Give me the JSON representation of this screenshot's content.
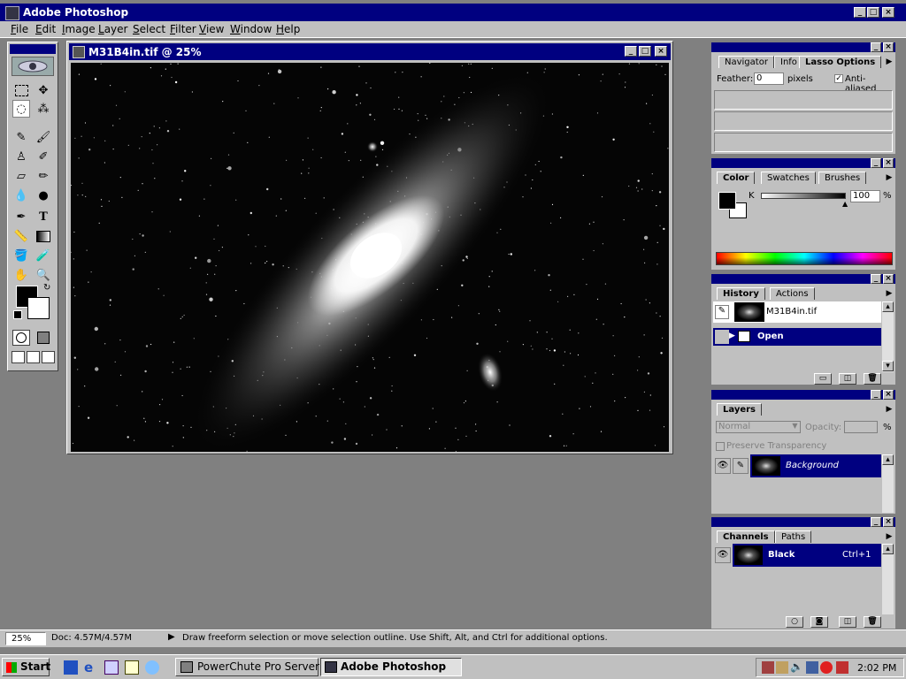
{
  "app": {
    "title": "Adobe Photoshop"
  },
  "menu": [
    "File",
    "Edit",
    "Image",
    "Layer",
    "Select",
    "Filter",
    "View",
    "Window",
    "Help"
  ],
  "document": {
    "title": "M31B4in.tif @ 25%"
  },
  "lasso_palette": {
    "tabs": [
      "Navigator",
      "Info",
      "Lasso Options"
    ],
    "feather_label": "Feather:",
    "feather_value": "0",
    "feather_unit": "pixels",
    "antialiased_label": "Anti-aliased",
    "antialiased_checked": true
  },
  "color_palette": {
    "tabs": [
      "Color",
      "Swatches",
      "Brushes"
    ],
    "channel_label": "K",
    "channel_value": "100",
    "channel_unit": "%",
    "slider_fraction": 1.0
  },
  "history_palette": {
    "tabs": [
      "History",
      "Actions"
    ],
    "snapshot_name": "M31B4in.tif",
    "state_name": "Open"
  },
  "layers_palette": {
    "tabs": [
      "Layers"
    ],
    "blend_mode": "Normal",
    "opacity_label": "Opacity:",
    "opacity_unit": "%",
    "preserve_label": "Preserve Transparency",
    "layer_name": "Background"
  },
  "channels_palette": {
    "tabs": [
      "Channels",
      "Paths"
    ],
    "channel_name": "Black",
    "channel_shortcut": "Ctrl+1"
  },
  "status_bar": {
    "zoom": "25%",
    "doc_info": "Doc: 4.57M/4.57M",
    "hint": "Draw freeform selection or move selection outline.  Use Shift, Alt, and Ctrl for additional options."
  },
  "taskbar": {
    "start": "Start",
    "tasks": [
      "PowerChute Pro Server",
      "Adobe Photoshop"
    ],
    "clock": "2:02 PM"
  },
  "colors": {
    "titlebar": "#000080",
    "face": "#c0c0c0",
    "workspace": "#808080",
    "foreground": "#000000",
    "background": "#ffffff"
  }
}
